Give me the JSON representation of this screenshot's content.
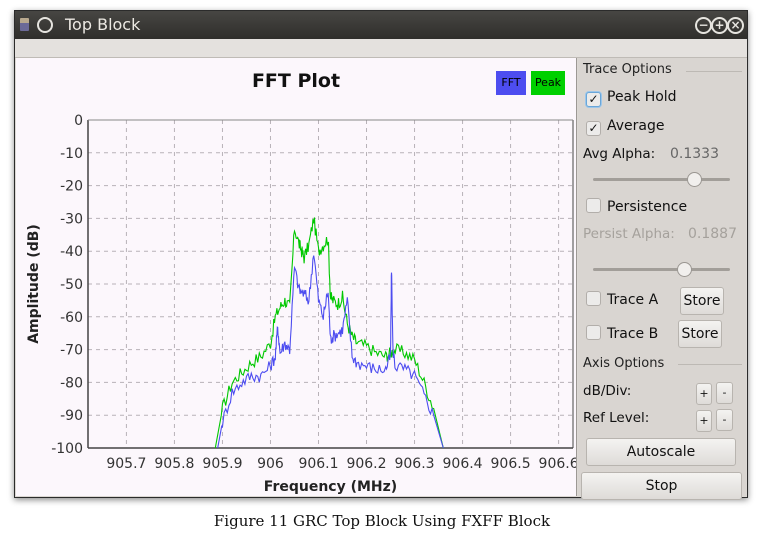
{
  "window": {
    "title": "Top Block",
    "controls": {
      "minimize_icon": "minus-circle-icon",
      "maximize_icon": "plus-circle-icon",
      "close_icon": "x-circle-icon"
    }
  },
  "plot": {
    "legend": [
      {
        "label": "FFT",
        "color": "#4d4df0"
      },
      {
        "label": "Peak",
        "color": "#00d000"
      }
    ]
  },
  "trace_options": {
    "title": "Trace Options",
    "peak_hold": {
      "label": "Peak Hold",
      "checked": true
    },
    "average": {
      "label": "Average",
      "checked": true
    },
    "avg_alpha": {
      "label": "Avg Alpha:",
      "value": "0.1333",
      "slider_fraction": 0.73
    },
    "persistence": {
      "label": "Persistence",
      "checked": false
    },
    "persist_alpha": {
      "label": "Persist Alpha:",
      "value": "0.1887",
      "slider_fraction": 0.66,
      "disabled": true
    },
    "trace_a": {
      "label": "Trace A",
      "checked": false,
      "button": "Store"
    },
    "trace_b": {
      "label": "Trace B",
      "checked": false,
      "button": "Store"
    }
  },
  "axis_options": {
    "title": "Axis Options",
    "db_div": {
      "label": "dB/Div:",
      "plus": "+",
      "minus": "-"
    },
    "ref_level": {
      "label": "Ref Level:",
      "plus": "+",
      "minus": "-"
    },
    "autoscale": "Autoscale"
  },
  "stop_button": "Stop",
  "caption": "Figure 11 GRC Top Block Using FXFF Block",
  "chart_data": {
    "type": "line",
    "title": "FFT Plot",
    "xlabel": "Frequency (MHz)",
    "ylabel": "Amplitude (dB)",
    "xlim": [
      905.62,
      906.63
    ],
    "ylim": [
      -100,
      0
    ],
    "xticks": [
      "905.7",
      "905.8",
      "905.9",
      "906",
      "906.1",
      "906.2",
      "906.3",
      "906.4",
      "906.5",
      "906.6"
    ],
    "xtick_values": [
      905.7,
      905.8,
      905.9,
      906.0,
      906.1,
      906.2,
      906.3,
      906.4,
      906.5,
      906.6
    ],
    "yticks": [
      "0",
      "-10",
      "-20",
      "-30",
      "-40",
      "-50",
      "-60",
      "-70",
      "-80",
      "-90",
      "-100"
    ],
    "ytick_values": [
      0,
      -10,
      -20,
      -30,
      -40,
      -50,
      -60,
      -70,
      -80,
      -90,
      -100
    ],
    "grid": true,
    "legend_position": "top-right",
    "series": [
      {
        "name": "Peak",
        "color": "#00c800",
        "x": [
          905.885,
          905.9,
          905.92,
          905.94,
          905.96,
          905.98,
          906.0,
          906.01,
          906.02,
          906.03,
          906.04,
          906.05,
          906.06,
          906.065,
          906.07,
          906.08,
          906.09,
          906.1,
          906.11,
          906.12,
          906.125,
          906.13,
          906.14,
          906.15,
          906.16,
          906.17,
          906.18,
          906.2,
          906.22,
          906.24,
          906.25,
          906.26,
          906.28,
          906.3,
          906.32,
          906.34,
          906.36
        ],
        "y": [
          -100,
          -88,
          -80,
          -77,
          -74,
          -72,
          -68,
          -60,
          -57,
          -55,
          -57,
          -33,
          -38,
          -40,
          -42,
          -38,
          -30,
          -40,
          -38,
          -36,
          -54,
          -55,
          -56,
          -54,
          -62,
          -66,
          -68,
          -69,
          -71,
          -72,
          -71,
          -70,
          -71,
          -73,
          -80,
          -88,
          -100
        ]
      },
      {
        "name": "FFT",
        "color": "#4d4df0",
        "x": [
          905.89,
          905.9,
          905.92,
          905.94,
          905.96,
          905.98,
          906.0,
          906.01,
          906.015,
          906.02,
          906.03,
          906.04,
          906.05,
          906.06,
          906.07,
          906.08,
          906.09,
          906.1,
          906.11,
          906.12,
          906.125,
          906.13,
          906.14,
          906.15,
          906.16,
          906.17,
          906.18,
          906.2,
          906.22,
          906.24,
          906.25,
          906.252,
          906.255,
          906.26,
          906.28,
          906.3,
          906.32,
          906.34,
          906.36
        ],
        "y": [
          -100,
          -92,
          -83,
          -80,
          -78,
          -78,
          -75,
          -72,
          -63,
          -71,
          -68,
          -70,
          -45,
          -52,
          -53,
          -55,
          -40,
          -55,
          -60,
          -52,
          -67,
          -66,
          -65,
          -64,
          -55,
          -72,
          -74,
          -75,
          -76,
          -76,
          -72,
          -45,
          -70,
          -75,
          -76,
          -78,
          -84,
          -90,
          -100
        ]
      }
    ]
  }
}
